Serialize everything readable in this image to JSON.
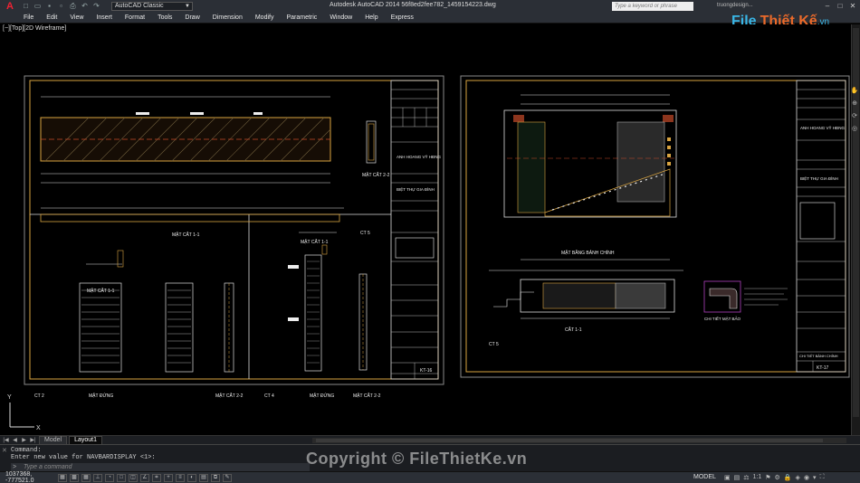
{
  "titlebar": {
    "app_title": "Autodesk AutoCAD 2014    56f8ed2fee782_1459154223.dwg",
    "workspace": "AutoCAD Classic",
    "search_placeholder": "Type a keyword or phrase",
    "user": "truongdesign...",
    "quick_access_icons": [
      "new-icon",
      "open-icon",
      "save-icon",
      "saveas-icon",
      "print-icon",
      "undo-icon",
      "redo-icon"
    ]
  },
  "menu": [
    "File",
    "Edit",
    "View",
    "Insert",
    "Format",
    "Tools",
    "Draw",
    "Dimension",
    "Modify",
    "Parametric",
    "Window",
    "Help",
    "Express"
  ],
  "brand": {
    "part1": "File",
    "part2": "Thiết Kế",
    "part3": ".vn"
  },
  "viewport": {
    "label": "[−][Top][2D Wireframe]",
    "sheet1": {
      "labels": {
        "section11": "MẶT CẮT 1-1",
        "section22": "MẶT CẮT 2-2",
        "ct5": "CT 5",
        "section11b": "MẶT CẮT 1-1",
        "section11c": "MẶT CẮT 1-1",
        "ct2": "CT 2",
        "elev1": "MẶT ĐỨNG",
        "section22b": "MẶT CẮT 2-2",
        "ct4": "CT 4",
        "elev2": "MẶT ĐỨNG",
        "section22c": "MẶT CẮT 2-2"
      },
      "titleblock": {
        "client": "ANH HOANG VỸ HĐNG",
        "project": "BIỆT THỰ GIA ĐÌNH",
        "sheet_no": "KT-16"
      }
    },
    "sheet2": {
      "labels": {
        "plan": "MẶT BẰNG BẢNH CHÍNH",
        "section11": "CẮT 1-1",
        "detail": "CHI TIẾT MẶT BẢO",
        "ct5": "CT 5"
      },
      "titleblock": {
        "client": "ANH HOANG VỸ HĐNG",
        "project": "BIỆT THỰ GIA ĐÌNH",
        "sheet_title": "CHI TIẾT BẢNH CHÍNH",
        "sheet_no": "KT-17"
      }
    }
  },
  "navbar": [
    "pan-icon",
    "zoom-icon",
    "orbit-icon",
    "wheel-icon"
  ],
  "tabs": {
    "model": "Model",
    "layout": "Layout1"
  },
  "command": {
    "line1": "Command:",
    "line2": "Enter new value for NAVBARDISPLAY <1>:",
    "input_placeholder": "Type a command"
  },
  "watermark": "Copyright © FileThietKe.vn",
  "status": {
    "coords": "1037368, -777521.0",
    "model": "MODEL",
    "scale": "1:1"
  }
}
